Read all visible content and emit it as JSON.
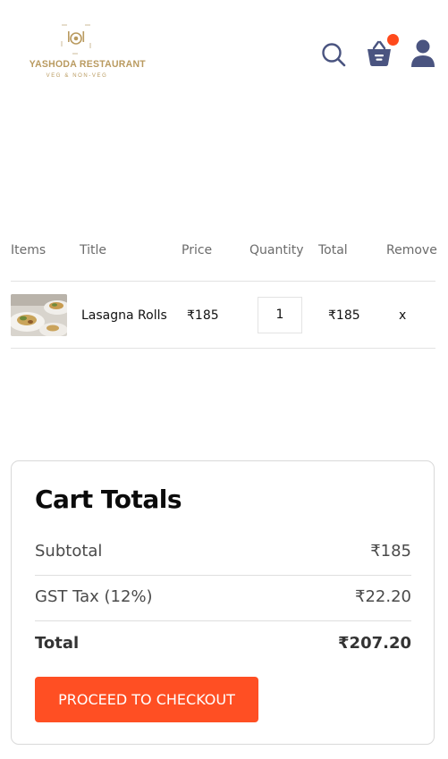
{
  "brand": {
    "name": "YASHODA RESTAURANT",
    "tagline": "VEG & NON-VEG",
    "gold": "#b99a5f"
  },
  "header": {
    "icons": [
      "search-icon",
      "basket-icon",
      "user-icon"
    ],
    "cart_badge_color": "#ff4a1c",
    "icon_color": "#4a5480"
  },
  "table": {
    "headers": [
      "Items",
      "Title",
      "Price",
      "Quantity",
      "Total",
      "Remove"
    ],
    "rows": [
      {
        "title": "Lasagna Rolls",
        "price": "₹185",
        "quantity": "1",
        "total": "₹185",
        "remove": "x"
      }
    ]
  },
  "totals": {
    "title": "Cart Totals",
    "subtotal_label": "Subtotal",
    "subtotal_value": "₹185",
    "tax_label": "GST Tax (12%)",
    "tax_value": "₹22.20",
    "total_label": "Total",
    "total_value": "₹207.20",
    "checkout_label": "PROCEED TO CHECKOUT",
    "accent": "#ff4f23"
  }
}
